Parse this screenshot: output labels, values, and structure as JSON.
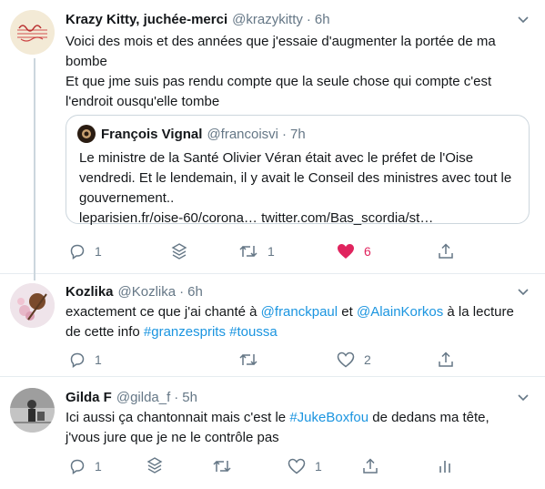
{
  "tweets": [
    {
      "name": "Krazy Kitty, juchée-merci",
      "handle": "@krazykitty",
      "time": "6h",
      "lines": [
        "Voici des mois et des années que j'essaie d'augmenter la portée de ma",
        "bombe",
        "Et que jme suis pas rendu compte que la seule chose qui compte c'est",
        "l'endroit ousqu'elle tombe"
      ],
      "quote": {
        "name": "François Vignal",
        "handle": "@francoisvi",
        "time": "7h",
        "lines": [
          "Le ministre de la Santé Olivier Véran était avec le préfet de l'Oise",
          "vendredi. Et le lendemain, il y avait le Conseil des ministres avec tout le",
          "gouvernement.."
        ],
        "link1": "leparisien.fr/oise-60/corona…",
        "link2": "twitter.com/Bas_scordia/st…"
      },
      "actions": {
        "replies": "1",
        "retweets": "1",
        "likes": "6"
      }
    },
    {
      "name": "Kozlika",
      "handle": "@Kozlika",
      "time": "6h",
      "text_a": "exactement ce que j'ai chanté à ",
      "mention1": "@franckpaul",
      "text_b": " et ",
      "mention2": "@AlainKorkos",
      "text_c": " à la lecture",
      "text_d": "de cette info ",
      "hashtag1": "#granzesprits",
      "hashtag2": "#toussa",
      "actions": {
        "replies": "1",
        "retweets": "",
        "likes": "2"
      }
    },
    {
      "name": "Gilda F",
      "handle": "@gilda_f",
      "time": "5h",
      "text_a": "Ici aussi ça chantonnait mais c'est le ",
      "hashtag": "#JukeBoxfou",
      "text_b": " de dedans ma tête,",
      "line2": "j'vous jure que je ne le contrôle pas",
      "actions": {
        "replies": "1",
        "retweets": "",
        "likes": "1"
      }
    }
  ],
  "separator": "·",
  "colors": {
    "accent": "#1b95e0",
    "like": "#e0245e",
    "muted": "#657786",
    "border": "#e6ecf0"
  }
}
